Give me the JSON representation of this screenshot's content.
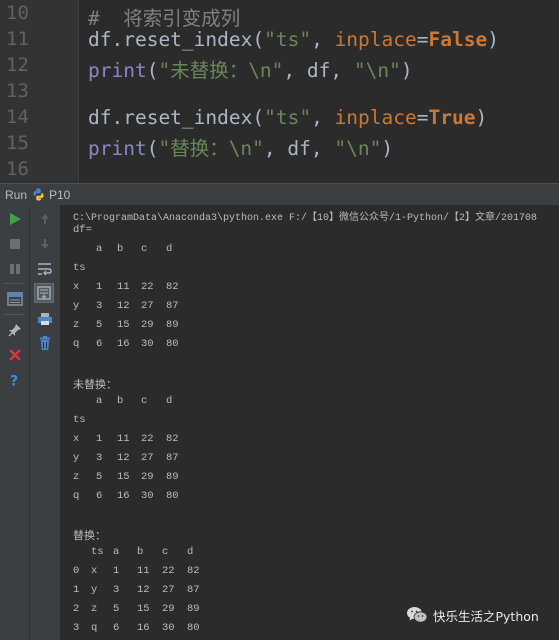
{
  "editor": {
    "lines": [
      {
        "number": "10",
        "tokens": [
          {
            "t": "#  将索引变成列",
            "c": "comment"
          }
        ]
      },
      {
        "number": "11",
        "tokens": [
          {
            "t": "df.reset_index(",
            "c": "text"
          },
          {
            "t": "\"ts\"",
            "c": "str"
          },
          {
            "t": ", ",
            "c": "text"
          },
          {
            "t": "inplace",
            "c": "kw"
          },
          {
            "t": "=",
            "c": "text"
          },
          {
            "t": "False",
            "c": "bool"
          },
          {
            "t": ")",
            "c": "text"
          }
        ]
      },
      {
        "number": "12",
        "tokens": [
          {
            "t": "print",
            "c": "builtin"
          },
          {
            "t": "(",
            "c": "text"
          },
          {
            "t": "\"未替换：\\n\"",
            "c": "str"
          },
          {
            "t": ", df, ",
            "c": "text"
          },
          {
            "t": "\"\\n\"",
            "c": "str"
          },
          {
            "t": ")",
            "c": "text"
          }
        ]
      },
      {
        "number": "13",
        "tokens": []
      },
      {
        "number": "14",
        "tokens": [
          {
            "t": "df.reset_index(",
            "c": "text"
          },
          {
            "t": "\"ts\"",
            "c": "str"
          },
          {
            "t": ", ",
            "c": "text"
          },
          {
            "t": "inplace",
            "c": "kw"
          },
          {
            "t": "=",
            "c": "text"
          },
          {
            "t": "True",
            "c": "bool"
          },
          {
            "t": ")",
            "c": "text"
          }
        ]
      },
      {
        "number": "15",
        "tokens": [
          {
            "t": "print",
            "c": "builtin"
          },
          {
            "t": "(",
            "c": "text"
          },
          {
            "t": "\"替换：\\n\"",
            "c": "str"
          },
          {
            "t": ", df, ",
            "c": "text"
          },
          {
            "t": "\"\\n\"",
            "c": "str"
          },
          {
            "t": ")",
            "c": "text"
          }
        ]
      },
      {
        "number": "16",
        "tokens": []
      }
    ]
  },
  "run_panel": {
    "label": "Run",
    "tab_label": "P10"
  },
  "toolbar": {
    "rerun_icon": "play-icon",
    "stop_icon": "stop-icon",
    "pause_icon": "pause-icon",
    "up_icon": "arrow-up-icon",
    "down_icon": "arrow-down-icon",
    "wrap_icon": "soft-wrap-icon",
    "scroll_icon": "scroll-to-end-icon",
    "print_icon": "print-icon",
    "trash_icon": "trash-icon",
    "layout_icon": "layout-icon",
    "pin_icon": "pin-icon",
    "close_icon": "close-icon",
    "help_icon": "help-icon"
  },
  "console": {
    "command": "C:\\ProgramData\\Anaconda3\\python.exe F:/【10】微信公众号/1-Python/【2】文章/201708",
    "df_label": "df=",
    "unreplaced_label": "未替换：",
    "replaced_label": "替换：",
    "table1": {
      "header": [
        "",
        "a",
        "b",
        "c",
        "d"
      ],
      "index_name": "ts",
      "rows": [
        [
          "x",
          "1",
          "11",
          "22",
          "82"
        ],
        [
          "y",
          "3",
          "12",
          "27",
          "87"
        ],
        [
          "z",
          "5",
          "15",
          "29",
          "89"
        ],
        [
          "q",
          "6",
          "16",
          "30",
          "80"
        ]
      ]
    },
    "table2": {
      "header": [
        "",
        "a",
        "b",
        "c",
        "d"
      ],
      "index_name": "ts",
      "rows": [
        [
          "x",
          "1",
          "11",
          "22",
          "82"
        ],
        [
          "y",
          "3",
          "12",
          "27",
          "87"
        ],
        [
          "z",
          "5",
          "15",
          "29",
          "89"
        ],
        [
          "q",
          "6",
          "16",
          "30",
          "80"
        ]
      ]
    },
    "table3": {
      "header": [
        "",
        "ts",
        "a",
        "b",
        "c",
        "d"
      ],
      "rows": [
        [
          "0",
          "x",
          "1",
          "11",
          "22",
          "82"
        ],
        [
          "1",
          "y",
          "3",
          "12",
          "27",
          "87"
        ],
        [
          "2",
          "z",
          "5",
          "15",
          "29",
          "89"
        ],
        [
          "3",
          "q",
          "6",
          "16",
          "30",
          "80"
        ]
      ]
    }
  },
  "watermark": {
    "text": "快乐生活之Python",
    "logo_icon": "wechat-logo-icon"
  },
  "colors": {
    "editor_bg": "#2b2b2b",
    "gutter_bg": "#313335",
    "comment": "#808080",
    "string": "#6a8759",
    "keyword": "#cc7832",
    "builtin": "#8888c6",
    "text": "#a9b7c6",
    "console_text": "#bbbbbb"
  }
}
